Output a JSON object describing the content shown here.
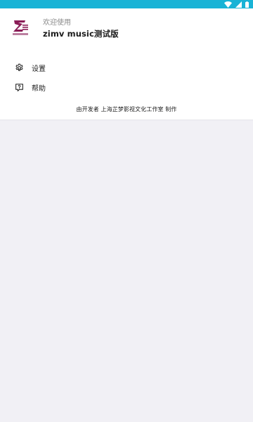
{
  "status_bar": {
    "color": "#19b3d6",
    "icons": [
      "wifi-icon",
      "signal-icon",
      "battery-icon"
    ]
  },
  "header": {
    "logo_icon": "zimv-logo",
    "welcome_text": "欢迎使用",
    "app_title": "zimv music测试版"
  },
  "menu": {
    "items": [
      {
        "icon": "gear-icon",
        "label": "设置"
      },
      {
        "icon": "help-icon",
        "label": "帮助"
      }
    ]
  },
  "footer": {
    "credit": "由开发者 上海芷梦影视文化工作室 制作"
  },
  "colors": {
    "accent": "#19b3d6",
    "logo_purple": "#8a1d57",
    "background": "#f1f0f5",
    "drawer": "#ffffff"
  }
}
